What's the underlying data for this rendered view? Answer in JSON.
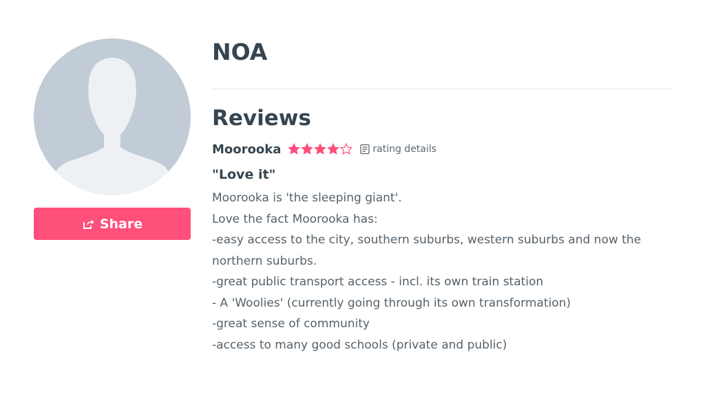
{
  "profile": {
    "name": "NOA",
    "share_label": "Share"
  },
  "reviews": {
    "heading": "Reviews",
    "items": [
      {
        "suburb": "Moorooka",
        "rating": 4,
        "rating_max": 5,
        "rating_details_label": "rating details",
        "title": "\"Love it\"",
        "lines": [
          "Moorooka is 'the sleeping giant'.",
          "Love the fact Moorooka has:",
          "-easy access to the city, southern suburbs, western suburbs and now the northern suburbs.",
          "-great public transport access - incl. its own train station",
          "- A 'Woolies' (currently going through its own transformation)",
          "-great sense of community",
          "-access to many good schools (private and public)"
        ]
      }
    ]
  },
  "colors": {
    "accent": "#ff4f7b",
    "text_dark": "#36454f",
    "text_body": "#55616a",
    "avatar_bg": "#c2ccd6",
    "avatar_silhouette": "#eef1f4",
    "divider": "#e3e6e8"
  },
  "icons": {
    "share": "share-icon",
    "star_filled": "star-filled-icon",
    "star_empty": "star-empty-icon",
    "rating_details": "document-icon"
  }
}
